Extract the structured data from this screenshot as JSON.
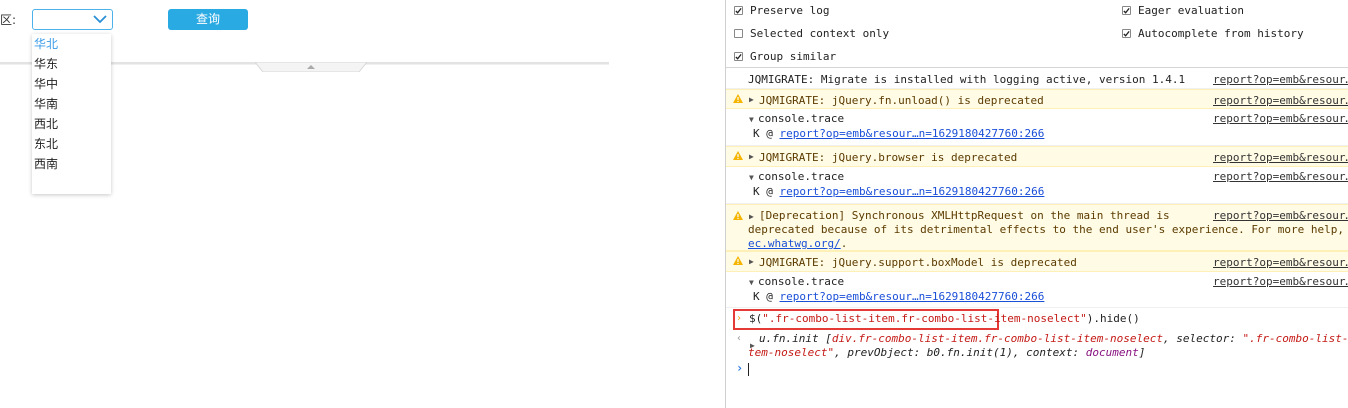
{
  "report": {
    "region_label": "区:",
    "region_combo_value": "",
    "query_button": "查询",
    "dropdown_items": [
      "华北",
      "华东",
      "华中",
      "华南",
      "西北",
      "东北",
      "西南"
    ],
    "selected_item": "华北"
  },
  "console": {
    "settings": {
      "preserve_log": "Preserve log",
      "selected_context_only": "Selected context only",
      "group_similar": "Group similar",
      "eager_evaluation": "Eager evaluation",
      "autocomplete_from_history": "Autocomplete from history"
    },
    "messages": {
      "m1": "JQMIGRATE: Migrate is installed with logging active, version 1.4.1",
      "m2": "JQMIGRATE: jQuery.fn.unload() is deprecated",
      "m3": "JQMIGRATE: jQuery.browser is deprecated",
      "m4_line1": "[Deprecation] Synchronous XMLHttpRequest on the main thread is",
      "m4_line2": "deprecated because of its detrimental effects to the end user's experience. For more help,",
      "m4_link": "ec.whatwg.org/",
      "m4_tail": ".",
      "m5": "JQMIGRATE: jQuery.support.boxModel is deprecated",
      "trace": "console.trace",
      "stack_prefix": "K @ ",
      "stack_link": "report?op=emb&resour…n=1629180427760:266",
      "source": "report?op=emb&resour…"
    },
    "command": {
      "prefix": "$(",
      "string": "\".fr-combo-list-item.fr-combo-list-item-noselect\"",
      "suffix": ").hide()"
    },
    "result": {
      "l1_a": "u.fn.init [",
      "l1_b": "div.fr-combo-list-item.fr-combo-list-item-noselect",
      "l1_c": ", selector: ",
      "l1_d": "\".fr-combo-list-i",
      "l2_a": "tem-noselect\"",
      "l2_b": ", prevObject: b0.fn.init(1), context: ",
      "l2_c": "document",
      "l2_d": "]"
    }
  }
}
